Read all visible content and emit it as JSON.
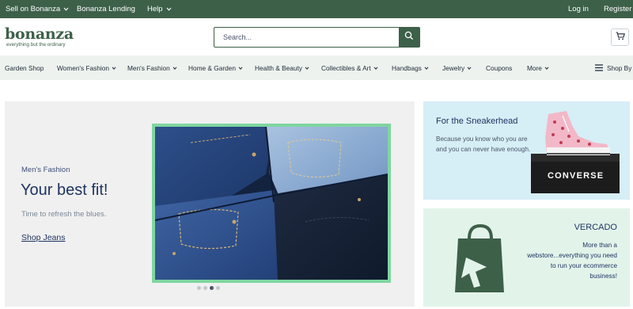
{
  "topbar": {
    "sell_label": "Sell on Bonanza",
    "lending_label": "Bonanza Lending",
    "help_label": "Help",
    "login_label": "Log in",
    "register_label": "Register"
  },
  "header": {
    "logo_text": "bonanza",
    "logo_tagline": "everything but the ordinary",
    "search_placeholder": "Search...",
    "search_value": ""
  },
  "nav": {
    "items": [
      {
        "label": "Garden Shop",
        "dropdown": false
      },
      {
        "label": "Women's Fashion",
        "dropdown": true
      },
      {
        "label": "Men's Fashion",
        "dropdown": true
      },
      {
        "label": "Home & Garden",
        "dropdown": true
      },
      {
        "label": "Health & Beauty",
        "dropdown": true
      },
      {
        "label": "Collectibles & Art",
        "dropdown": true
      },
      {
        "label": "Handbags",
        "dropdown": true
      },
      {
        "label": "Jewelry",
        "dropdown": true
      },
      {
        "label": "Coupons",
        "dropdown": false
      },
      {
        "label": "More",
        "dropdown": true
      }
    ],
    "shop_by_label": "Shop By"
  },
  "hero": {
    "subtitle": "Men's Fashion",
    "title": "Your best fit!",
    "description": "Time to refresh the blues.",
    "link_label": "Shop Jeans",
    "image_icon": "folded-jeans-photo",
    "slide_count": 4,
    "active_slide": 3
  },
  "promo1": {
    "title": "For the Sneakerhead",
    "text": "Because you know who you are and you can never have enough.",
    "image_icon": "pink-converse-sneaker-on-box",
    "box_brand": "CONVERSE"
  },
  "promo2": {
    "title": "VERCADO",
    "text": "More than a webstore...everything you need to run your ecommerce business!",
    "image_icon": "shopping-bag-logo"
  },
  "colors": {
    "brand_green": "#3d6049",
    "nav_bg": "#edf2ee",
    "hero_frame": "#7fd6a0",
    "promo1_bg": "#d6eef6",
    "promo2_bg": "#e2f4ea",
    "heading_navy": "#1f3461"
  }
}
